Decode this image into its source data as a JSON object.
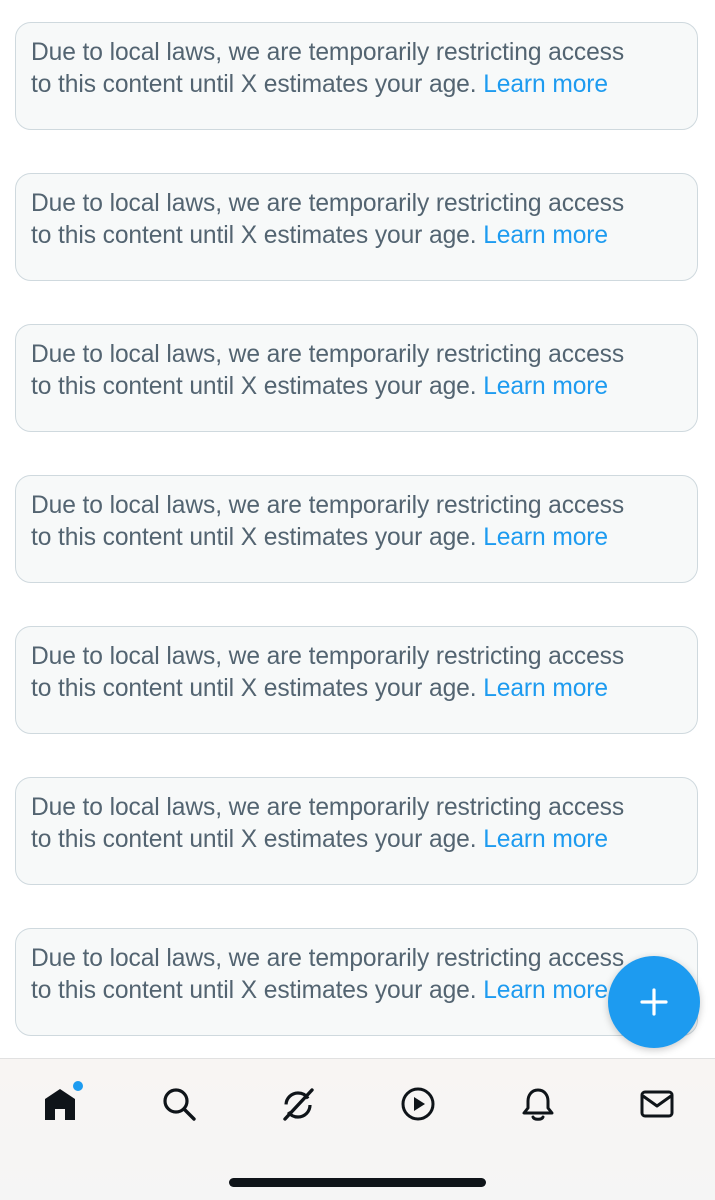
{
  "feed": {
    "notices": [
      {
        "line1": "Due to local laws, we are temporarily restricting access",
        "line2": "to this content until X estimates your age.",
        "link": "Learn more"
      },
      {
        "line1": "Due to local laws, we are temporarily restricting access",
        "line2": "to this content until X estimates your age.",
        "link": "Learn more"
      },
      {
        "line1": "Due to local laws, we are temporarily restricting access",
        "line2": "to this content until X estimates your age.",
        "link": "Learn more"
      },
      {
        "line1": "Due to local laws, we are temporarily restricting access",
        "line2": "to this content until X estimates your age.",
        "link": "Learn more"
      },
      {
        "line1": "Due to local laws, we are temporarily restricting access",
        "line2": "to this content until X estimates your age.",
        "link": "Learn more"
      },
      {
        "line1": "Due to local laws, we are temporarily restricting access",
        "line2": "to this content until X estimates your age.",
        "link": "Learn more"
      },
      {
        "line1": "Due to local laws, we are temporarily restricting access",
        "line2": "to this content until X estimates your age.",
        "link": "Learn more"
      }
    ]
  },
  "compose": {
    "icon": "plus-icon"
  },
  "tabbar": {
    "tabs": [
      {
        "id": "home",
        "icon": "home-icon",
        "active": true,
        "has_badge": true
      },
      {
        "id": "search",
        "icon": "search-icon",
        "active": false,
        "has_badge": false
      },
      {
        "id": "grok",
        "icon": "grok-icon",
        "active": false,
        "has_badge": false
      },
      {
        "id": "video",
        "icon": "play-circle-icon",
        "active": false,
        "has_badge": false
      },
      {
        "id": "notifications",
        "icon": "bell-icon",
        "active": false,
        "has_badge": false
      },
      {
        "id": "messages",
        "icon": "envelope-icon",
        "active": false,
        "has_badge": false
      }
    ]
  },
  "colors": {
    "link": "#1d9bf0",
    "notice_text": "#536471",
    "notice_bg": "#f7f9f9",
    "notice_border": "#cfd9de",
    "fab": "#1d9bf0",
    "icon": "#0f1419"
  }
}
